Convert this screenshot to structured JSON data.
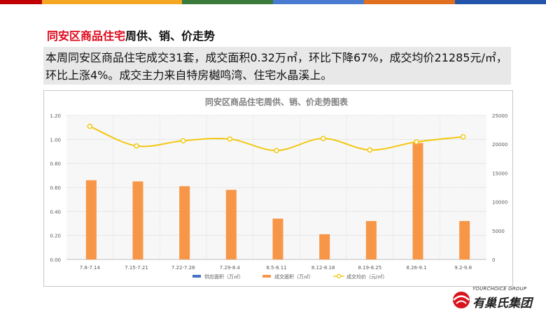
{
  "top_bar_colors": [
    "#c00000",
    "#f5a623",
    "#3a7a3a",
    "#4a7bd0",
    "#e07020",
    "#2255aa",
    "#333333"
  ],
  "heading": {
    "red_part": "同安区商品住宅",
    "black_part": "周供、销、价走势"
  },
  "summary": "本周同安区商品住宅成交31套，成交面积0.32万㎡，环比下降67%，成交均价21285元/㎡，环比上涨4%。成交主力来自特房樾鸣湾、住宅水晶溪上。",
  "chart_data": {
    "type": "bar+line",
    "title": "同安区商品住宅周供、销、价走势图表",
    "categories": [
      "7.8-7.14",
      "7.15-7.21",
      "7.22-7.28",
      "7.29-8.4",
      "8.5-8.11",
      "8.12-8.18",
      "8.19-8.25",
      "8.26-9.1",
      "9.2-9.8"
    ],
    "left_axis": {
      "min": 0,
      "max": 1.2,
      "ticks": [
        "0.00",
        "0.20",
        "0.40",
        "0.60",
        "0.80",
        "1.00",
        "1.20"
      ]
    },
    "right_axis": {
      "min": 0,
      "max": 25000,
      "ticks": [
        "0",
        "5000",
        "10000",
        "15000",
        "20000",
        "25000"
      ]
    },
    "series": [
      {
        "name": "供应面积（万㎡）",
        "type": "bar",
        "axis": "left",
        "color": "#4472c4",
        "values": [
          0,
          0,
          0,
          0,
          0,
          0,
          0,
          0,
          0
        ]
      },
      {
        "name": "成交面积（万㎡）",
        "type": "bar",
        "axis": "left",
        "color": "#f79646",
        "values": [
          0.66,
          0.65,
          0.61,
          0.58,
          0.34,
          0.21,
          0.32,
          0.97,
          0.32
        ]
      },
      {
        "name": "成交均价（元/㎡）",
        "type": "line",
        "axis": "right",
        "color": "#f2c811",
        "values": [
          23100,
          19700,
          20600,
          20900,
          18900,
          21000,
          19000,
          20400,
          21285
        ]
      }
    ],
    "legend_position": "bottom",
    "grid": true
  },
  "logo": {
    "tagline": "YOURCHOICE GROUP",
    "name": "有巢氏集团"
  }
}
